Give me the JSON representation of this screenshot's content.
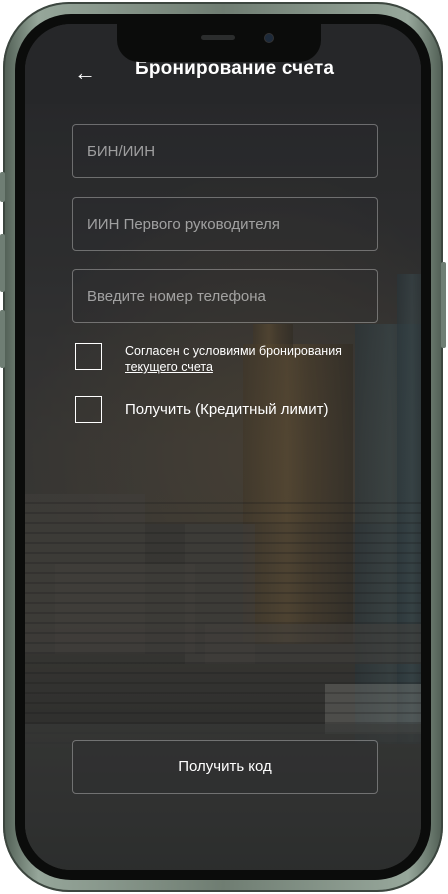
{
  "header": {
    "back_icon": "←",
    "title": "Бронирование счета"
  },
  "form": {
    "bin_placeholder": "БИН/ИИН",
    "director_iin_placeholder": "ИИН Первого руководителя",
    "phone_placeholder": "Введите номер телефона",
    "agree_label_line1": "Согласен с условиями бронирования",
    "agree_label_link": "текущего счета",
    "credit_limit_label": "Получить (Кредитный лимит)",
    "submit_label": "Получить код"
  },
  "colors": {
    "header_bg": "#262729",
    "phone_frame": "#6f7d72",
    "text": "#ffffff"
  }
}
